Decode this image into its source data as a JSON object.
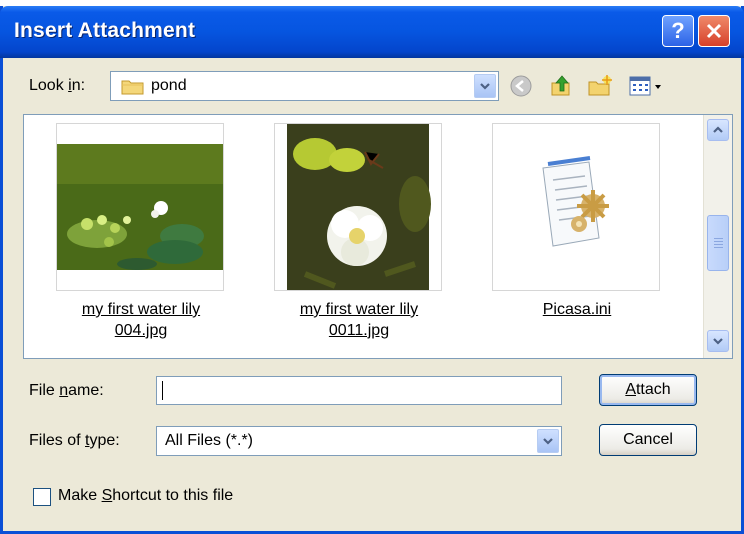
{
  "titlebar": {
    "title": "Insert Attachment",
    "help_icon": "help-icon",
    "close_icon": "close-icon"
  },
  "lookin": {
    "label_pre": "Look ",
    "label_mnemonic": "i",
    "label_post": "n:",
    "value": "pond",
    "folder_icon": "folder-icon"
  },
  "toolbar": {
    "icons": [
      "back-icon",
      "up-folder-icon",
      "new-folder-icon",
      "views-menu-icon"
    ]
  },
  "files": [
    {
      "name": "my first water lily 004.jpg",
      "line1": "my first water lily",
      "line2": "004.jpg",
      "type": "image"
    },
    {
      "name": "my first water lily 0011.jpg",
      "line1": "my first water lily",
      "line2": "0011.jpg",
      "type": "image"
    },
    {
      "name": "Picasa.ini",
      "line1": "Picasa.ini",
      "line2": "",
      "type": "settings-file"
    }
  ],
  "filename": {
    "label_pre": "File ",
    "label_mnemonic": "n",
    "label_post": "ame:",
    "value": ""
  },
  "filetype": {
    "label_pre": "Files of ",
    "label_mnemonic": "t",
    "label_post": "ype:",
    "value": "All Files (*.*)"
  },
  "buttons": {
    "attach_mnemonic": "A",
    "attach_rest": "ttach",
    "cancel": "Cancel"
  },
  "shortcut": {
    "label_pre": "Make ",
    "label_mnemonic": "S",
    "label_post": "hortcut to this file",
    "checked": false
  }
}
